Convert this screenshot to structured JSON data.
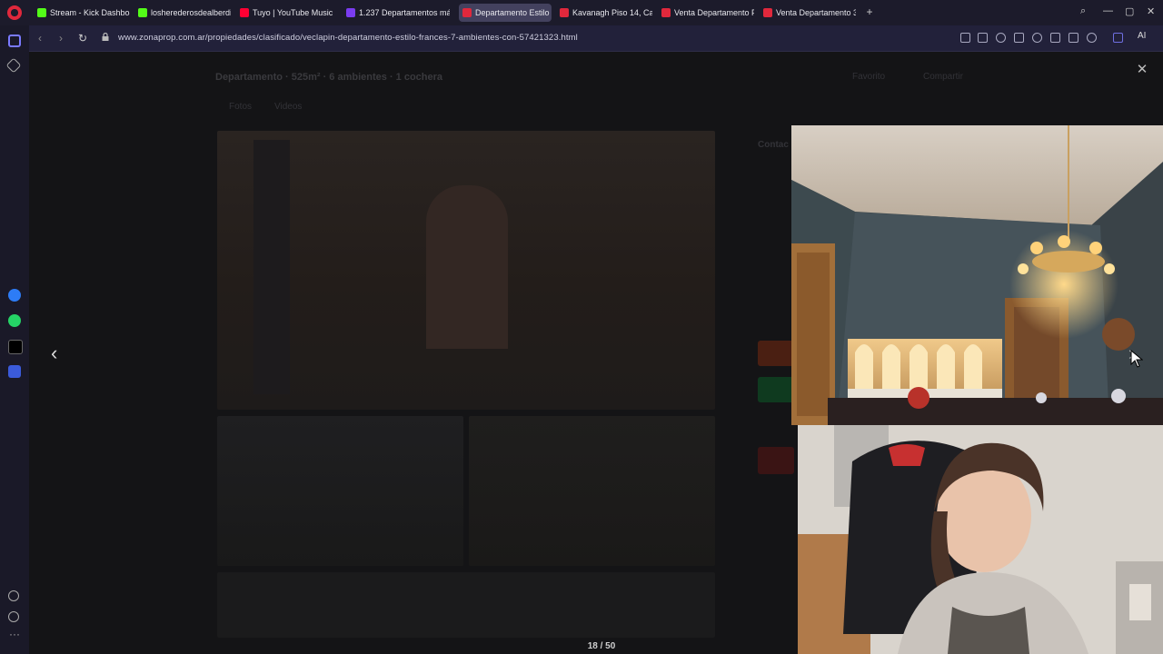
{
  "tabs": [
    {
      "label": "Stream - Kick Dashboard",
      "fav": "#53fc18"
    },
    {
      "label": "losherederosdealberdi",
      "fav": "#53fc18"
    },
    {
      "label": "Tuyo | YouTube Music",
      "fav": "#ff0033"
    },
    {
      "label": "1.237 Departamentos má",
      "fav": "#7a3cf0"
    },
    {
      "label": "Departamento Estilo Fran",
      "fav": "#e0283c",
      "active": true
    },
    {
      "label": "Kavanagh Piso 14, Capital",
      "fav": "#e0283c"
    },
    {
      "label": "Venta Departamento Fran",
      "fav": "#e0283c"
    },
    {
      "label": "Venta Departamento 3 Am",
      "fav": "#e0283c"
    }
  ],
  "address": {
    "url": "www.zonaprop.com.ar/propiedades/clasificado/veclapin-departamento-estilo-frances-7-ambientes-con-57421323.html",
    "ai_label": "AI"
  },
  "listing": {
    "title": "Departamento · 525m² · 6 ambientes · 1 cochera",
    "favorite_label": "Favorito",
    "share_label": "Compartir",
    "tab_photos": "Fotos",
    "tab_videos": "Videos",
    "contact_label": "Contac"
  },
  "gallery": {
    "counter": "18 / 50",
    "close_icon": "close-icon",
    "prev_icon": "chevron-left-icon",
    "next_icon": "chevron-right-icon"
  },
  "colors": {
    "accent": "#e0283c",
    "tabbar": "#1c1b2b",
    "addrbar": "#22213a"
  }
}
